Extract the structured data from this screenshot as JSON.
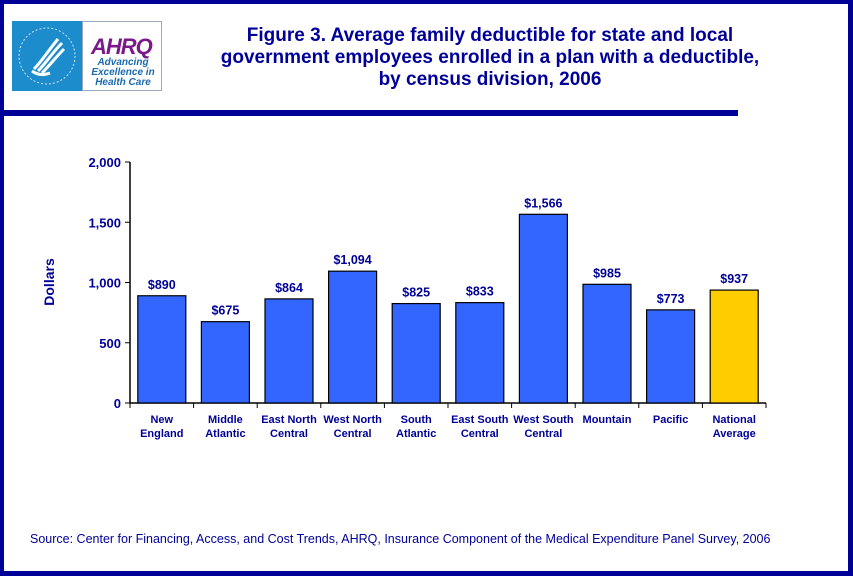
{
  "logo": {
    "hhs_icon": "hhs-eagle-seal-icon",
    "ahrq_wordmark": "AHRQ",
    "ahrq_tagline": [
      "Advancing",
      "Excellence in",
      "Health Care"
    ]
  },
  "header": {
    "title_lines": [
      "Figure 3. Average family deductible for state and local",
      "government  employees enrolled in a plan with a deductible,",
      "by census division, 2006"
    ]
  },
  "footer": {
    "source": "Source: Center for Financing, Access, and Cost Trends, AHRQ, Insurance Component of the Medical Expenditure Panel Survey, 2006"
  },
  "colors": {
    "frame": "#000099",
    "bar": "#3366ff",
    "highlight_bar": "#ffcc00",
    "text": "#000099"
  },
  "chart_data": {
    "type": "bar",
    "title": "Figure 3. Average family deductible for state and local government employees enrolled in a plan with a deductible, by census division, 2006",
    "xlabel": "",
    "ylabel": "Dollars",
    "ylim": [
      0,
      2000
    ],
    "yticks": [
      0,
      500,
      1000,
      1500,
      2000
    ],
    "ytick_labels": [
      "0",
      "500",
      "1,000",
      "1,500",
      "2,000"
    ],
    "grid": false,
    "legend": "none",
    "categories": [
      [
        "New",
        "England"
      ],
      [
        "Middle",
        "Atlantic"
      ],
      [
        "East North",
        "Central"
      ],
      [
        "West North",
        "Central"
      ],
      [
        "South",
        "Atlantic"
      ],
      [
        "East South",
        "Central"
      ],
      [
        "West South",
        "Central"
      ],
      [
        "Mountain"
      ],
      [
        "Pacific"
      ],
      [
        "National",
        "Average"
      ]
    ],
    "values": [
      890,
      675,
      864,
      1094,
      825,
      833,
      1566,
      985,
      773,
      937
    ],
    "data_labels": [
      "$890",
      "$675",
      "$864",
      "$1,094",
      "$825",
      "$833",
      "$1,566",
      "$985",
      "$773",
      "$937"
    ],
    "highlight_index": 9
  }
}
